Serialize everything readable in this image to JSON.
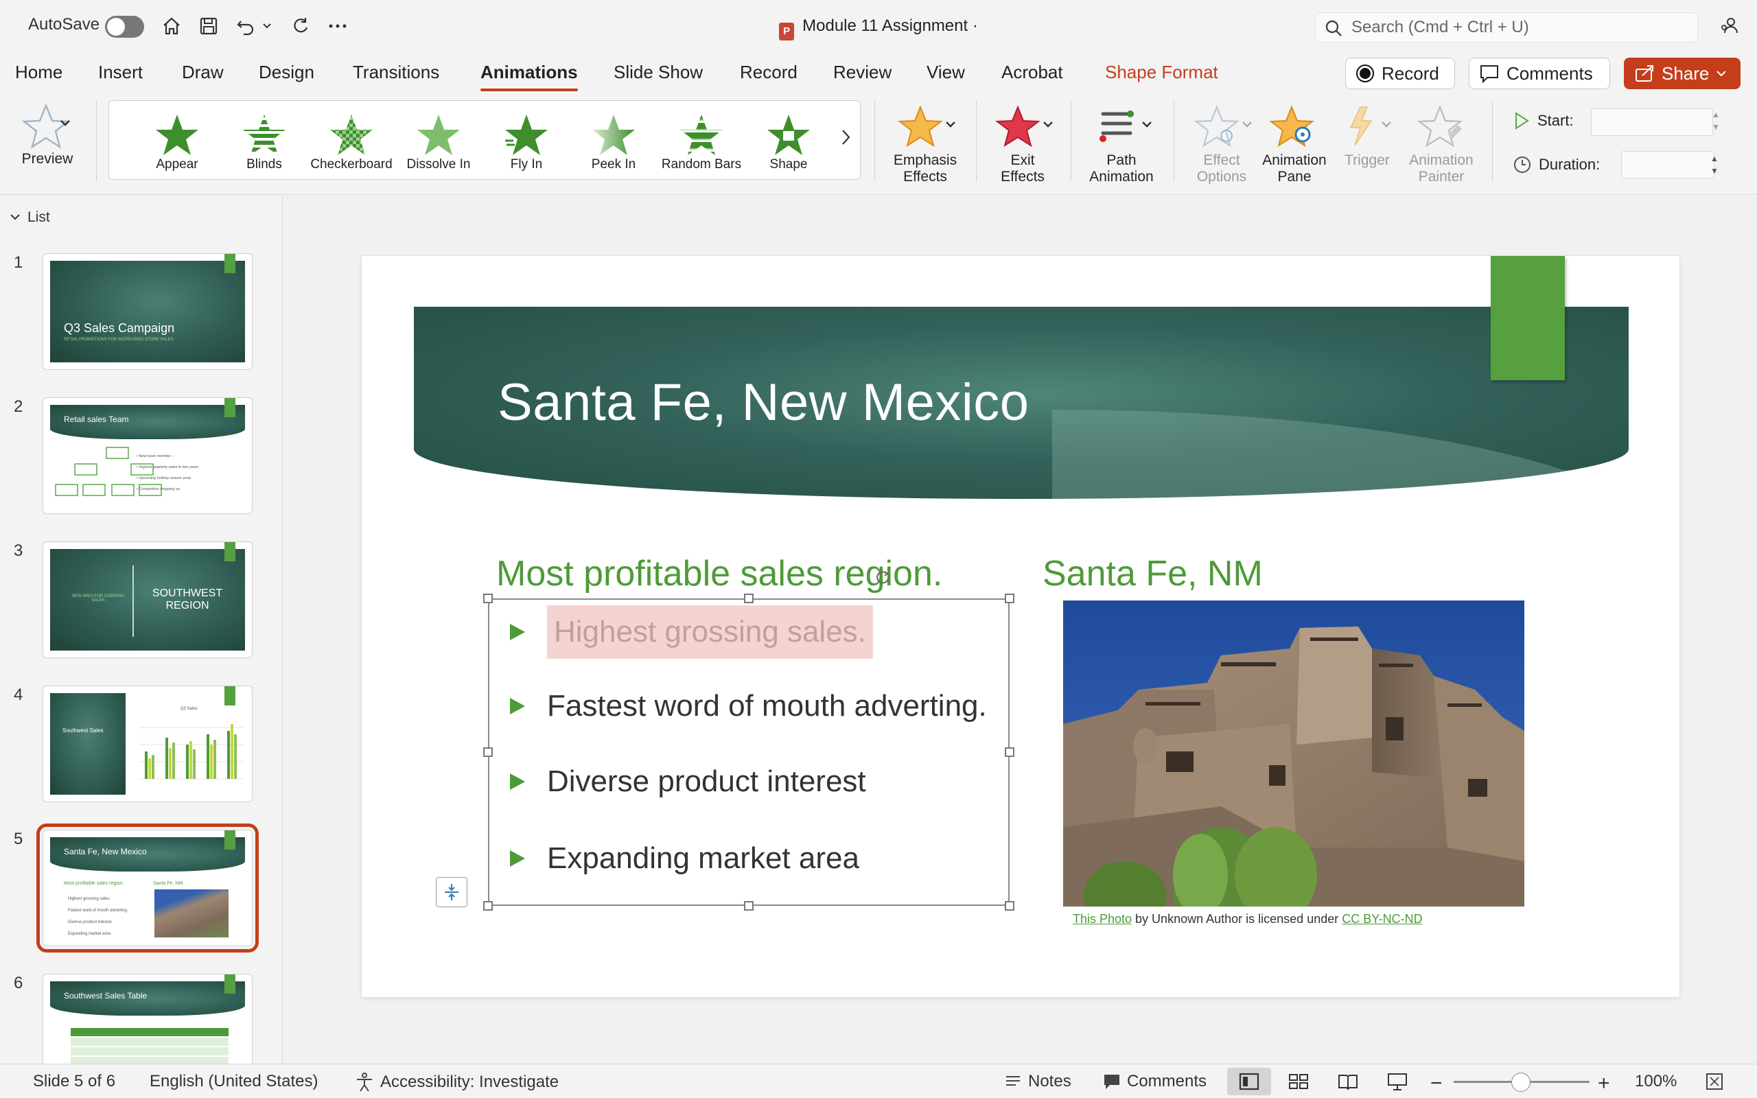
{
  "titlebar": {
    "autosave_label": "AutoSave",
    "doc_title": "Module 11 Assignment ·",
    "search_placeholder": "Search (Cmd + Ctrl + U)"
  },
  "tabs": [
    {
      "label": "Home"
    },
    {
      "label": "Insert"
    },
    {
      "label": "Draw"
    },
    {
      "label": "Design"
    },
    {
      "label": "Transitions"
    },
    {
      "label": "Animations"
    },
    {
      "label": "Slide Show"
    },
    {
      "label": "Record"
    },
    {
      "label": "Review"
    },
    {
      "label": "View"
    },
    {
      "label": "Acrobat"
    },
    {
      "label": "Shape Format"
    }
  ],
  "top_buttons": {
    "record": "Record",
    "comments": "Comments",
    "share": "Share"
  },
  "ribbon": {
    "preview": "Preview",
    "gallery": [
      "Appear",
      "Blinds",
      "Checkerboard",
      "Dissolve In",
      "Fly In",
      "Peek In",
      "Random Bars",
      "Shape"
    ],
    "emphasis": [
      "Emphasis",
      "Effects"
    ],
    "exit": [
      "Exit",
      "Effects"
    ],
    "path": [
      "Path",
      "Animation"
    ],
    "effect_options": [
      "Effect",
      "Options"
    ],
    "animation_pane": [
      "Animation",
      "Pane"
    ],
    "trigger": "Trigger",
    "animation_painter": [
      "Animation",
      "Painter"
    ],
    "start_label": "Start:",
    "duration_label": "Duration:"
  },
  "slide_panel": {
    "header": "List",
    "slides": [
      {
        "num": "1",
        "title": "Q3 Sales Campaign",
        "sub": "RETAIL PROMOTIONS FOR INCREASING STORE SALES"
      },
      {
        "num": "2",
        "title": "Retail sales Team"
      },
      {
        "num": "3",
        "title": "SOUTHWEST REGION",
        "sub": "NEW AREA FOR COMPANY SALES"
      },
      {
        "num": "4",
        "title": "Southwest Sales",
        "sub": "Q3 Sales"
      },
      {
        "num": "5",
        "title": "Santa Fe, New Mexico",
        "sub": "Most profitable sales region."
      },
      {
        "num": "6",
        "title": "Southwest Sales Table"
      }
    ]
  },
  "slide": {
    "title": "Santa Fe, New Mexico",
    "left_heading": "Most profitable sales region.",
    "bullets": [
      "Highest grossing sales.",
      "Fastest word of mouth adverting.",
      "Diverse product interest",
      "Expanding market area"
    ],
    "right_heading": "Santa Fe, NM",
    "caption": {
      "link1": "This Photo",
      "middle": " by Unknown Author is licensed under ",
      "link2": "CC BY-NC-ND"
    }
  },
  "statusbar": {
    "slide_info": "Slide 5 of 6",
    "language": "English (United States)",
    "accessibility": "Accessibility: Investigate",
    "notes": "Notes",
    "comments": "Comments",
    "zoom": "100%"
  },
  "colors": {
    "accent": "#c43e1c",
    "slide_green": "#4e9a38",
    "banner": "#2f5c52"
  }
}
